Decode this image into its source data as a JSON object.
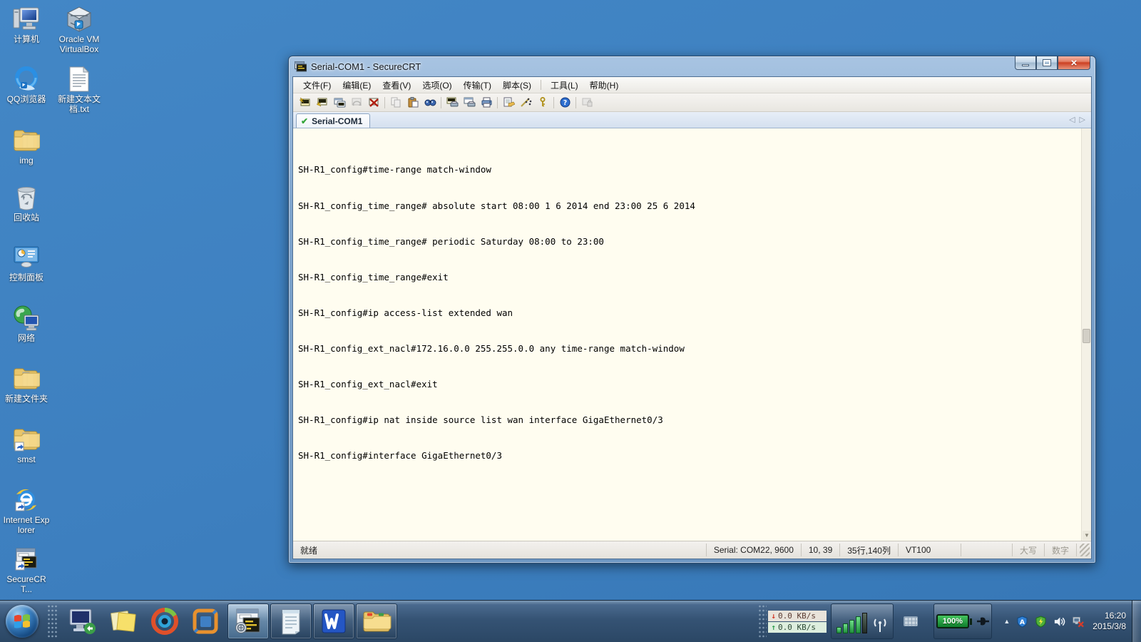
{
  "desktop": {
    "icons": [
      {
        "label": "计算机",
        "icon": "computer-icon"
      },
      {
        "label": "Oracle VM VirtualBox",
        "icon": "virtualbox-icon"
      },
      {
        "label": "QQ浏览器",
        "icon": "qq-browser-icon"
      },
      {
        "label": "新建文本文档.txt",
        "icon": "text-file-icon"
      },
      {
        "label": "img",
        "icon": "folder-icon"
      },
      {
        "label": "回收站",
        "icon": "recycle-bin-icon"
      },
      {
        "label": "控制面板",
        "icon": "control-panel-icon"
      },
      {
        "label": "网络",
        "icon": "network-icon"
      },
      {
        "label": "新建文件夹",
        "icon": "folder-icon"
      },
      {
        "label": "smst",
        "icon": "folder-shortcut-icon"
      },
      {
        "label": "Internet Explorer",
        "icon": "ie-icon"
      },
      {
        "label": "SecureCRT...",
        "icon": "securecrt-shortcut-icon"
      }
    ]
  },
  "window": {
    "title": "Serial-COM1 - SecureCRT",
    "menu": [
      "文件(F)",
      "编辑(E)",
      "查看(V)",
      "选项(O)",
      "传输(T)",
      "脚本(S)",
      "工具(L)",
      "帮助(H)"
    ],
    "toolbar_icons": [
      "quick-connect",
      "connect",
      "connect-in-tab",
      "reconnect",
      "disconnect",
      "copy",
      "paste",
      "find",
      "print-screen",
      "print-eject",
      "print",
      "session-options",
      "global-options",
      "keygen",
      "help",
      "session-lock"
    ],
    "tab_label": "Serial-COM1",
    "terminal_lines": [
      "SH-R1_config#time-range match-window",
      "SH-R1_config_time_range# absolute start 08:00 1 6 2014 end 23:00 25 6 2014",
      "SH-R1_config_time_range# periodic Saturday 08:00 to 23:00",
      "SH-R1_config_time_range#exit",
      "SH-R1_config#ip access-list extended wan",
      "SH-R1_config_ext_nacl#172.16.0.0 255.255.0.0 any time-range match-window",
      "SH-R1_config_ext_nacl#exit",
      "SH-R1_config#ip nat inside source list wan interface GigaEthernet0/3",
      "SH-R1_config#interface GigaEthernet0/3"
    ],
    "status": {
      "ready": "就绪",
      "serial": "Serial: COM22, 9600",
      "cursor": "10, 39",
      "size": "35行,140列",
      "emulation": "VT100",
      "caps": "大写",
      "num": "数字"
    }
  },
  "taskbar": {
    "pinned_icons": [
      "remote-desktop",
      "sticky-notes",
      "media-player",
      "vmware"
    ],
    "running_apps": [
      "securecrt",
      "notepad",
      "wps-writer",
      "explorer"
    ],
    "tray": {
      "download_speed": "0.0 KB/s",
      "upload_speed": "0.0 KB/s",
      "battery_percent": "100%",
      "time": "16:20",
      "date": "2015/3/8"
    }
  },
  "colors": {
    "desktop_bg": "#3d7fbf",
    "terminal_bg": "#fffdf0",
    "titlebar_blue": "#7fa5cd",
    "taskbar_dark": "#355374",
    "close_button_red": "#cc3f22",
    "tab_check_green": "#35a53c"
  }
}
